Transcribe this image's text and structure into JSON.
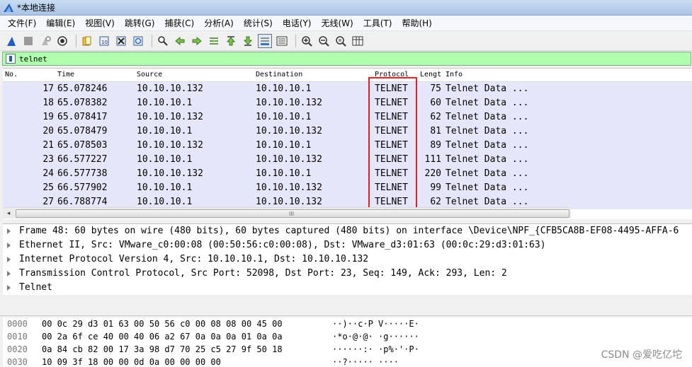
{
  "window": {
    "title": "*本地连接"
  },
  "menu": [
    "文件(F)",
    "编辑(E)",
    "视图(V)",
    "跳转(G)",
    "捕获(C)",
    "分析(A)",
    "统计(S)",
    "电话(Y)",
    "无线(W)",
    "工具(T)",
    "帮助(H)"
  ],
  "filter": {
    "value": "telnet"
  },
  "packet_list": {
    "columns": [
      "No.",
      "Time",
      "Source",
      "Destination",
      "Protocol",
      "Lengt",
      "Info"
    ],
    "rows": [
      [
        "17",
        "65.078246",
        "10.10.10.132",
        "10.10.10.1",
        "TELNET",
        "75",
        "Telnet Data ..."
      ],
      [
        "18",
        "65.078382",
        "10.10.10.1",
        "10.10.10.132",
        "TELNET",
        "60",
        "Telnet Data ..."
      ],
      [
        "19",
        "65.078417",
        "10.10.10.132",
        "10.10.10.1",
        "TELNET",
        "62",
        "Telnet Data ..."
      ],
      [
        "20",
        "65.078479",
        "10.10.10.1",
        "10.10.10.132",
        "TELNET",
        "81",
        "Telnet Data ..."
      ],
      [
        "21",
        "65.078503",
        "10.10.10.132",
        "10.10.10.1",
        "TELNET",
        "89",
        "Telnet Data ..."
      ],
      [
        "23",
        "66.577227",
        "10.10.10.1",
        "10.10.10.132",
        "TELNET",
        "111",
        "Telnet Data ..."
      ],
      [
        "24",
        "66.577738",
        "10.10.10.132",
        "10.10.10.1",
        "TELNET",
        "220",
        "Telnet Data ..."
      ],
      [
        "25",
        "66.577902",
        "10.10.10.1",
        "10.10.10.132",
        "TELNET",
        "99",
        "Telnet Data ..."
      ],
      [
        "27",
        "66.788774",
        "10.10.10.1",
        "10.10.10.132",
        "TELNET",
        "62",
        "Telnet Data ..."
      ]
    ]
  },
  "details": [
    "Frame 48: 60 bytes on wire (480 bits), 60 bytes captured (480 bits) on interface \\Device\\NPF_{CFB5CA8B-EF08-4495-AFFA-6",
    "Ethernet II, Src: VMware_c0:00:08 (00:50:56:c0:00:08), Dst: VMware_d3:01:63 (00:0c:29:d3:01:63)",
    "Internet Protocol Version 4, Src: 10.10.10.1, Dst: 10.10.10.132",
    "Transmission Control Protocol, Src Port: 52098, Dst Port: 23, Seq: 149, Ack: 293, Len: 2",
    "Telnet"
  ],
  "bytes": [
    {
      "offset": "0000",
      "hex": "00 0c 29 d3 01 63 00 50  56 c0 00 08 08 00 45 00",
      "ascii": "··)··c·P V·····E·"
    },
    {
      "offset": "0010",
      "hex": "00 2a 6f ce 40 00 40 06  a2 67 0a 0a 0a 01 0a 0a",
      "ascii": "·*o·@·@· ·g······"
    },
    {
      "offset": "0020",
      "hex": "0a 84 cb 82 00 17 3a 98  d7 70 25 c5 27 9f 50 18",
      "ascii": "······:· ·p%·'·P·"
    },
    {
      "offset": "0030",
      "hex": "10 09 3f 18 00 00 0d 0a  00 00 00 00",
      "ascii": "··?····· ····"
    }
  ],
  "watermark": "CSDN @爱吃亿坨",
  "colors": {
    "row_bg": "#e6e6fa",
    "filter_bg": "#afffaf",
    "highlight": "#e02020"
  }
}
